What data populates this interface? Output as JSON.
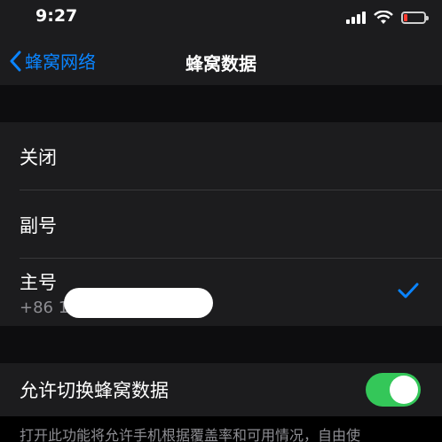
{
  "status_bar": {
    "time": "9:27",
    "battery_level": 0.2,
    "battery_color": "#ff3b30"
  },
  "nav": {
    "back_label": "蜂窝网络",
    "title": "蜂窝数据"
  },
  "options": [
    {
      "label": "关闭"
    },
    {
      "label": "副号"
    },
    {
      "label": "主号",
      "number": "+86 1",
      "selected": true
    }
  ],
  "toggle_row": {
    "label": "允许切换蜂窝数据",
    "state": "on",
    "on_color": "#34c759"
  },
  "footer_text": "打开此功能将允许手机根据覆盖率和可用情况，自由使",
  "colors": {
    "accent": "#0a84ff",
    "background": "#000000",
    "cell": "#1c1c1e"
  }
}
